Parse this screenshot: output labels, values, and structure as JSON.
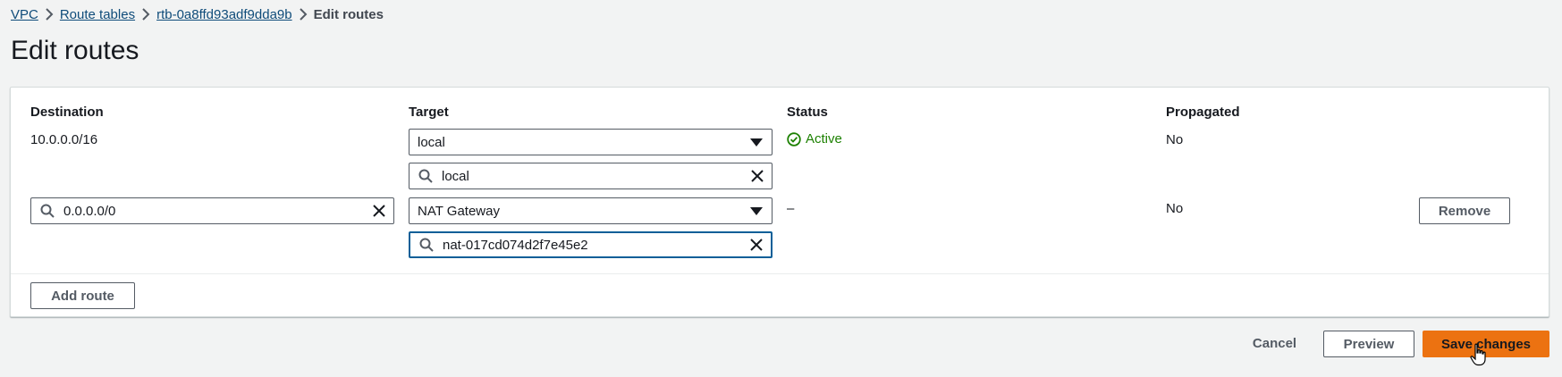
{
  "breadcrumb": {
    "items": [
      "VPC",
      "Route tables",
      "rtb-0a8ffd93adf9dda9b"
    ],
    "current": "Edit routes"
  },
  "page_title": "Edit routes",
  "table": {
    "headers": [
      "Destination",
      "Target",
      "Status",
      "Propagated"
    ],
    "rows": [
      {
        "destination": "10.0.0.0/16",
        "target_type": "local",
        "target_value": "local",
        "status": "Active",
        "propagated": "No"
      },
      {
        "destination": "0.0.0.0/0",
        "target_type": "NAT Gateway",
        "target_value": "nat-017cd074d2f7e45e2",
        "status": "–",
        "propagated": "No",
        "remove_label": "Remove"
      }
    ]
  },
  "add_route_label": "Add route",
  "footer": {
    "cancel_label": "Cancel",
    "preview_label": "Preview",
    "save_label": "Save changes"
  },
  "colors": {
    "accent": "#ec7211",
    "link": "#0f4c7a",
    "status_active": "#1d8102",
    "focus": "#0a5f98"
  }
}
